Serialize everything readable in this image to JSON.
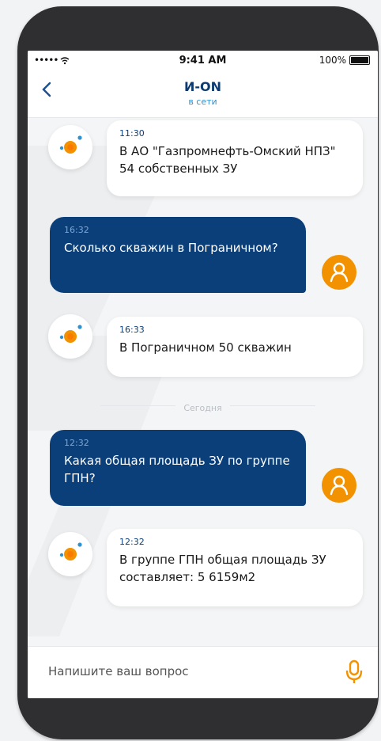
{
  "status_bar": {
    "signal": "•••••",
    "wifi": "wifi-icon",
    "time": "9:41 AM",
    "battery_pct": "100%"
  },
  "header": {
    "back": "<",
    "title": "И-ON",
    "subtitle": "в сети"
  },
  "messages": [
    {
      "sender": "bot",
      "time": "11:30",
      "text": "В АО \"Газпромнефть-Омский НПЗ\" 54 собственных ЗУ"
    },
    {
      "sender": "user",
      "time": "16:32",
      "text": "Сколько скважин в Пограничном?"
    },
    {
      "sender": "bot",
      "time": "16:33",
      "text": "В Пограничном 50 скважин"
    },
    {
      "sender": "user",
      "time": "12:32",
      "text": "Какая общая площадь ЗУ по группе ГПН?"
    },
    {
      "sender": "bot",
      "time": "12:32",
      "text": "В группе ГПН общая площадь ЗУ составляет: 5 6159м2"
    }
  ],
  "divider": {
    "label": "Сегодня"
  },
  "composer": {
    "placeholder": "Напишите ваш вопрос",
    "mic_icon": "microphone-icon"
  },
  "colors": {
    "primary": "#0b3f7a",
    "accent": "#f39200",
    "online": "#2f91cf"
  }
}
